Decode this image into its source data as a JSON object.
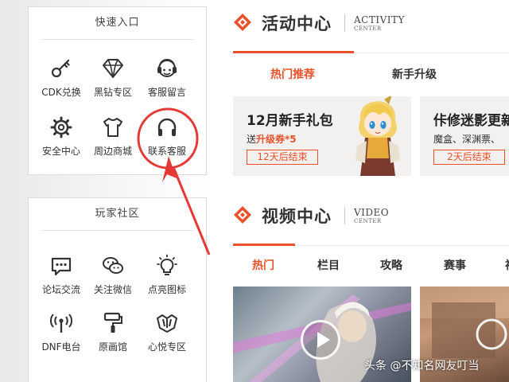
{
  "colors": {
    "accent": "#e8512a",
    "annotation": "#e53935"
  },
  "quick_entry": {
    "title": "快速入口",
    "items": [
      {
        "label": "CDK兑换",
        "icon": "key-icon"
      },
      {
        "label": "黑钻专区",
        "icon": "diamond-icon"
      },
      {
        "label": "客服留言",
        "icon": "headset-agent-icon"
      },
      {
        "label": "安全中心",
        "icon": "gear-icon"
      },
      {
        "label": "周边商城",
        "icon": "tshirt-icon"
      },
      {
        "label": "联系客服",
        "icon": "headphones-icon"
      }
    ]
  },
  "community": {
    "title": "玩家社区",
    "items": [
      {
        "label": "论坛交流",
        "icon": "chat-bubble-icon"
      },
      {
        "label": "关注微信",
        "icon": "wechat-icon"
      },
      {
        "label": "点亮图标",
        "icon": "lightbulb-icon"
      },
      {
        "label": "DNF电台",
        "icon": "radio-antenna-icon"
      },
      {
        "label": "原画馆",
        "icon": "paint-roller-icon"
      },
      {
        "label": "心悦专区",
        "icon": "vip-crest-icon"
      }
    ]
  },
  "activity": {
    "title": "活动中心",
    "en_title": "ACTIVITY",
    "en_sub": "CENTER",
    "tabs": [
      "热门推荐",
      "新手升级"
    ],
    "cards": [
      {
        "title": "12月新手礼包",
        "sub_prefix": "送",
        "sub_highlight": "升级券*5",
        "badge": "12天后结束"
      },
      {
        "title": "佧修迷影更新",
        "sub": "魔盒、深渊票、",
        "badge": "2天后结束"
      }
    ]
  },
  "video": {
    "title": "视频中心",
    "en_title": "VIDEO",
    "en_sub": "CENTER",
    "tabs": [
      "热门",
      "栏目",
      "攻略",
      "赛事",
      "视"
    ]
  },
  "watermark": "头条 @不知名网友叮当"
}
